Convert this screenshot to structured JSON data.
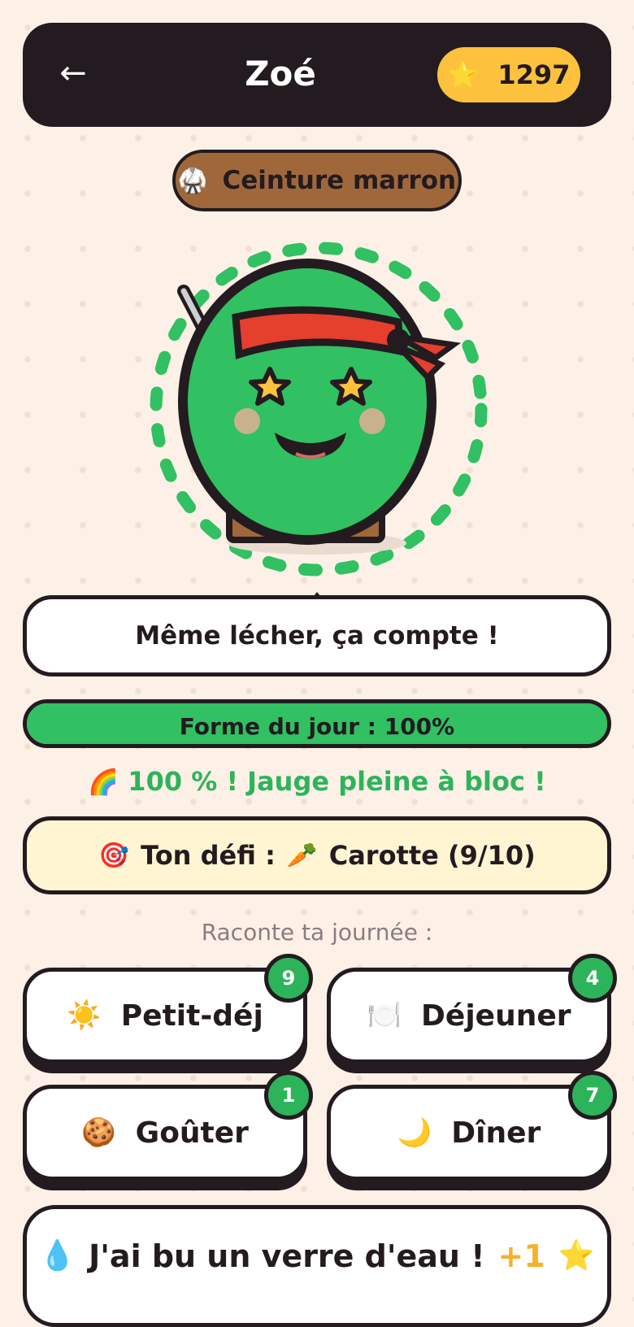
{
  "header": {
    "back_icon": "←",
    "title": "Zoé",
    "star_icon": "⭐",
    "star_count": "1297"
  },
  "belt": {
    "icon": "🥋",
    "label": "Ceinture marron"
  },
  "mascot": {
    "color": "#31c062",
    "headband_color": "#e53f2e",
    "eye_color": "#fcc23e"
  },
  "speech": {
    "text": "Même lécher, ça compte !"
  },
  "gauge": {
    "label": "Forme du jour : 100%",
    "percent": 100,
    "color": "#31c062"
  },
  "status_message": {
    "icon": "🌈",
    "text": "100 % ! Jauge pleine à bloc !"
  },
  "challenge": {
    "target_icon": "🎯",
    "label": "Ton défi :",
    "food_icon": "🥕",
    "food": "Carotte (9/10)"
  },
  "prompt": "Raconte ta journée :",
  "meals": [
    {
      "icon": "☀️",
      "label": "Petit-déj",
      "count": "9"
    },
    {
      "icon": "🍽️",
      "label": "Déjeuner",
      "count": "4"
    },
    {
      "icon": "🍪",
      "label": "Goûter",
      "count": "1"
    },
    {
      "icon": "🌙",
      "label": "Dîner",
      "count": "7"
    }
  ],
  "water": {
    "icon": "💧",
    "label": "J'ai bu un verre d'eau !",
    "bonus": "+1",
    "star_icon": "⭐"
  }
}
